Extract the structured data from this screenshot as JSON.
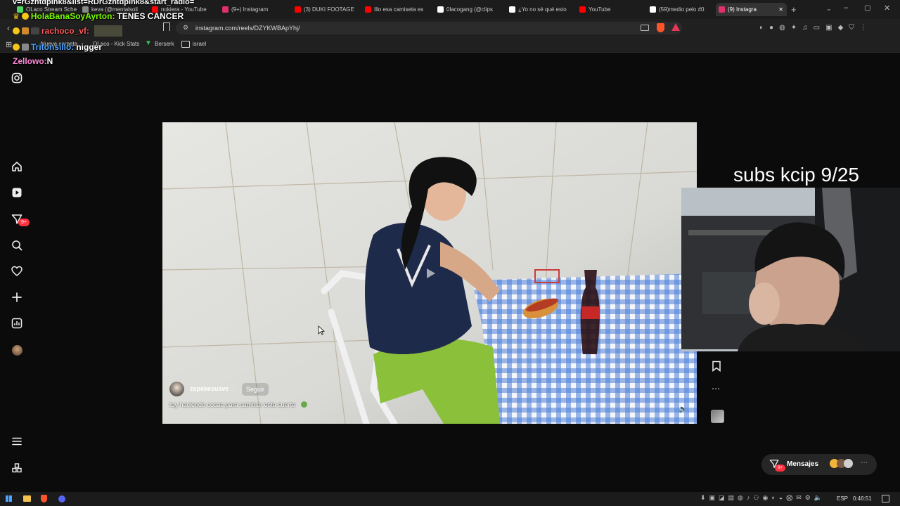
{
  "browser": {
    "tabs": [
      {
        "label": "OLaco Stream Sche",
        "color": "#4cd964"
      },
      {
        "label": "keva (@mentalsoli",
        "color": "#888888"
      },
      {
        "label": "nokiera - YouTube",
        "color": "#ff0000"
      },
      {
        "label": "(9+) Instagram",
        "color": "#e1306c"
      },
      {
        "label": "(3) DUKI FOOTAGE",
        "color": "#ff0000"
      },
      {
        "label": "Illo esa camiseta es",
        "color": "#ff0000"
      },
      {
        "label": "0lacogang (@clips",
        "color": "#ffffff"
      },
      {
        "label": "¿Yo no sé qué esto",
        "color": "#ffffff"
      },
      {
        "label": "YouTube",
        "color": "#ff0000"
      },
      {
        "label": "(59)medio pelo #0",
        "color": "#ffffff"
      },
      {
        "label": "(9) Instagra",
        "color": "#e1306c",
        "active": true
      }
    ],
    "url": "instagram.com/reels/DZYKWBApYhj/",
    "bookmarks": [
      {
        "label": "Nueva carpeta"
      },
      {
        "label": "OLaco - Kick Stats"
      },
      {
        "label": "Berserk"
      },
      {
        "label": "israel"
      }
    ]
  },
  "overlay": {
    "line1": "v=rGzhtdpInk8&list=RDrGzhtdpInk8&start_radio=",
    "line2_user": "HolaBanaSoyAyrton:",
    "line2_msg": " TENES CANCER",
    "line3_user": "rachoco_vf:",
    "line4_user": "Tritonsillo:",
    "line4_msg": " nigger",
    "line5_user": "Zellowo:",
    "line5_msg": " N",
    "subs": "subs kcip 9/25"
  },
  "sidebar": {
    "notif_badge": "9+"
  },
  "reel": {
    "username": "zepekesuave",
    "follow_label": "Seguir",
    "caption": "toy haciendo cosas para cambiar esta suerte"
  },
  "messages": {
    "label": "Mensajes",
    "badge": "9+"
  },
  "taskbar": {
    "lang": "ESP",
    "time": "0:46:51"
  }
}
